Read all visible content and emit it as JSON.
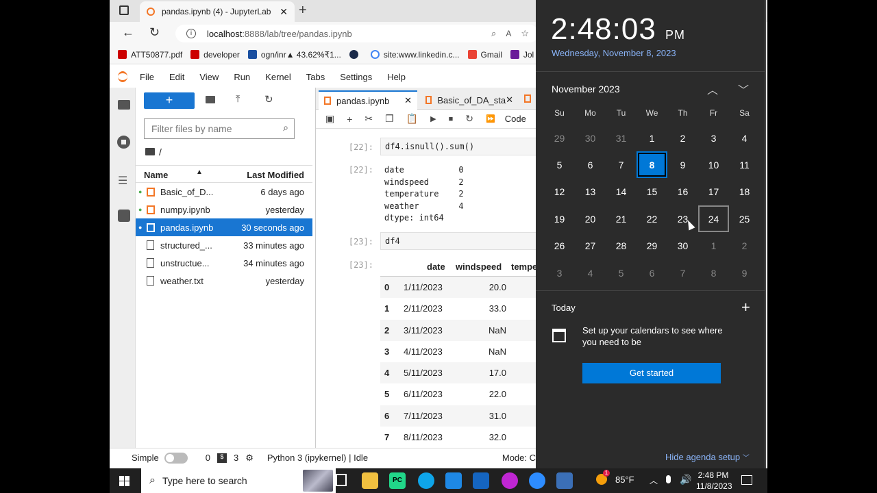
{
  "browser": {
    "tab_title": "pandas.ipynb (4) - JupyterLab",
    "url_host": "localhost",
    "url_rest": ":8888/lab/tree/pandas.ipynb",
    "bookmarks": [
      "ATT50877.pdf",
      "developer",
      "ogn/inr▲ 43.62%₹1...",
      "site:www.linkedin.c...",
      "Gmail",
      "Jol"
    ]
  },
  "menu": [
    "File",
    "Edit",
    "View",
    "Run",
    "Kernel",
    "Tabs",
    "Settings",
    "Help"
  ],
  "filebrowser": {
    "filter_placeholder": "Filter files by name",
    "path": "/",
    "col_name": "Name",
    "col_modified": "Last Modified",
    "files": [
      {
        "name": "Basic_of_D...",
        "modified": "6 days ago"
      },
      {
        "name": "numpy.ipynb",
        "modified": "yesterday"
      },
      {
        "name": "pandas.ipynb",
        "modified": "30 seconds ago"
      },
      {
        "name": "structured_...",
        "modified": "33 minutes ago"
      },
      {
        "name": "unstructue...",
        "modified": "34 minutes ago"
      },
      {
        "name": "weather.txt",
        "modified": "yesterday"
      }
    ]
  },
  "notebook": {
    "tabs": [
      "pandas.ipynb",
      "Basic_of_DA_sta"
    ],
    "cell_type": "Code",
    "cell1_prompt": "[22]:",
    "cell1_code": "df4.isnull().sum()",
    "out1_prompt": "[22]:",
    "out1_lines": [
      "date           0",
      "windspeed      2",
      "temperature    2",
      "weather        4",
      "dtype: int64"
    ],
    "cell2_prompt": "[23]:",
    "cell2_code": "df4",
    "out2_prompt": "[23]:",
    "table_headers": [
      "date",
      "windspeed",
      "tempe"
    ],
    "rows": [
      {
        "idx": "0",
        "date": "1/11/2023",
        "wind": "20.0"
      },
      {
        "idx": "1",
        "date": "2/11/2023",
        "wind": "33.0"
      },
      {
        "idx": "2",
        "date": "3/11/2023",
        "wind": "NaN"
      },
      {
        "idx": "3",
        "date": "4/11/2023",
        "wind": "NaN"
      },
      {
        "idx": "4",
        "date": "5/11/2023",
        "wind": "17.0"
      },
      {
        "idx": "5",
        "date": "6/11/2023",
        "wind": "22.0"
      },
      {
        "idx": "6",
        "date": "7/11/2023",
        "wind": "31.0"
      },
      {
        "idx": "7",
        "date": "8/11/2023",
        "wind": "32.0"
      }
    ]
  },
  "statusbar": {
    "mode_toggle": "Simple",
    "terminals": "0",
    "kernels": "3",
    "kernel": "Python 3 (ipykernel) | Idle",
    "mode": "Mode: C"
  },
  "clock": {
    "time": "2:48:03",
    "ampm": "PM",
    "date": "Wednesday, November 8, 2023",
    "month": "November 2023",
    "weekdays": [
      "Su",
      "Mo",
      "Tu",
      "We",
      "Th",
      "Fr",
      "Sa"
    ],
    "weeks": [
      [
        "29",
        "30",
        "31",
        "1",
        "2",
        "3",
        "4"
      ],
      [
        "5",
        "6",
        "7",
        "8",
        "9",
        "10",
        "11"
      ],
      [
        "12",
        "13",
        "14",
        "15",
        "16",
        "17",
        "18"
      ],
      [
        "19",
        "20",
        "21",
        "22",
        "23",
        "24",
        "25"
      ],
      [
        "26",
        "27",
        "28",
        "29",
        "30",
        "1",
        "2"
      ],
      [
        "3",
        "4",
        "5",
        "6",
        "7",
        "8",
        "9"
      ]
    ],
    "today_label": "Today",
    "agenda_text": "Set up your calendars to see where you need to be",
    "get_started": "Get started",
    "hide_agenda": "Hide agenda setup"
  },
  "taskbar": {
    "search_placeholder": "Type here to search",
    "weather_temp": "85°F",
    "weather_badge": "1",
    "time": "2:48 PM",
    "date": "11/8/2023"
  },
  "colors": {
    "jupyter_blue": "#1976d2",
    "selected_row": "#1976d2",
    "win_accent": "#0078d7",
    "panel_bg": "#2b2b2b"
  }
}
